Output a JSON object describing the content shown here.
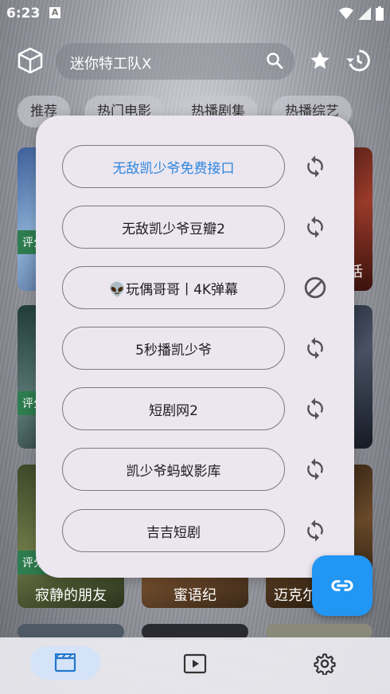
{
  "status_bar": {
    "time": "6:23",
    "a_label": "A"
  },
  "search": {
    "query": "迷你特工队X"
  },
  "tabs": [
    {
      "label": "推荐"
    },
    {
      "label": "热门电影"
    },
    {
      "label": "热播剧集"
    },
    {
      "label": "热播综艺"
    }
  ],
  "cards": {
    "badge": "评分",
    "row3_titles": [
      "寂静的朋友",
      "蜜语纪",
      "迈克尔"
    ],
    "row1_right_tail": "话"
  },
  "dialog": {
    "sources": [
      {
        "label": "无敌凯少爷免费接口",
        "icon": "sync-icon",
        "active": true
      },
      {
        "label": "无敌凯少爷豆瓣2",
        "icon": "sync-icon"
      },
      {
        "label": "👽玩偶哥哥丨4K弹幕",
        "icon": "block-icon"
      },
      {
        "label": "5秒播凯少爷",
        "icon": "sync-icon"
      },
      {
        "label": "短剧网2",
        "icon": "sync-icon"
      },
      {
        "label": "凯少爷蚂蚁影库",
        "icon": "sync-icon"
      },
      {
        "label": "吉吉短剧",
        "icon": "sync-icon"
      }
    ]
  },
  "fab": {
    "icon": "link-icon"
  },
  "bottom_nav": [
    {
      "icon": "movie-icon",
      "active": true
    },
    {
      "icon": "play-icon"
    },
    {
      "icon": "gear-icon"
    }
  ],
  "colors": {
    "accent": "#2196f3",
    "active_text": "#2e86de",
    "badge": "#2e7d4f",
    "dialog_bg": "#ebe6ef"
  }
}
